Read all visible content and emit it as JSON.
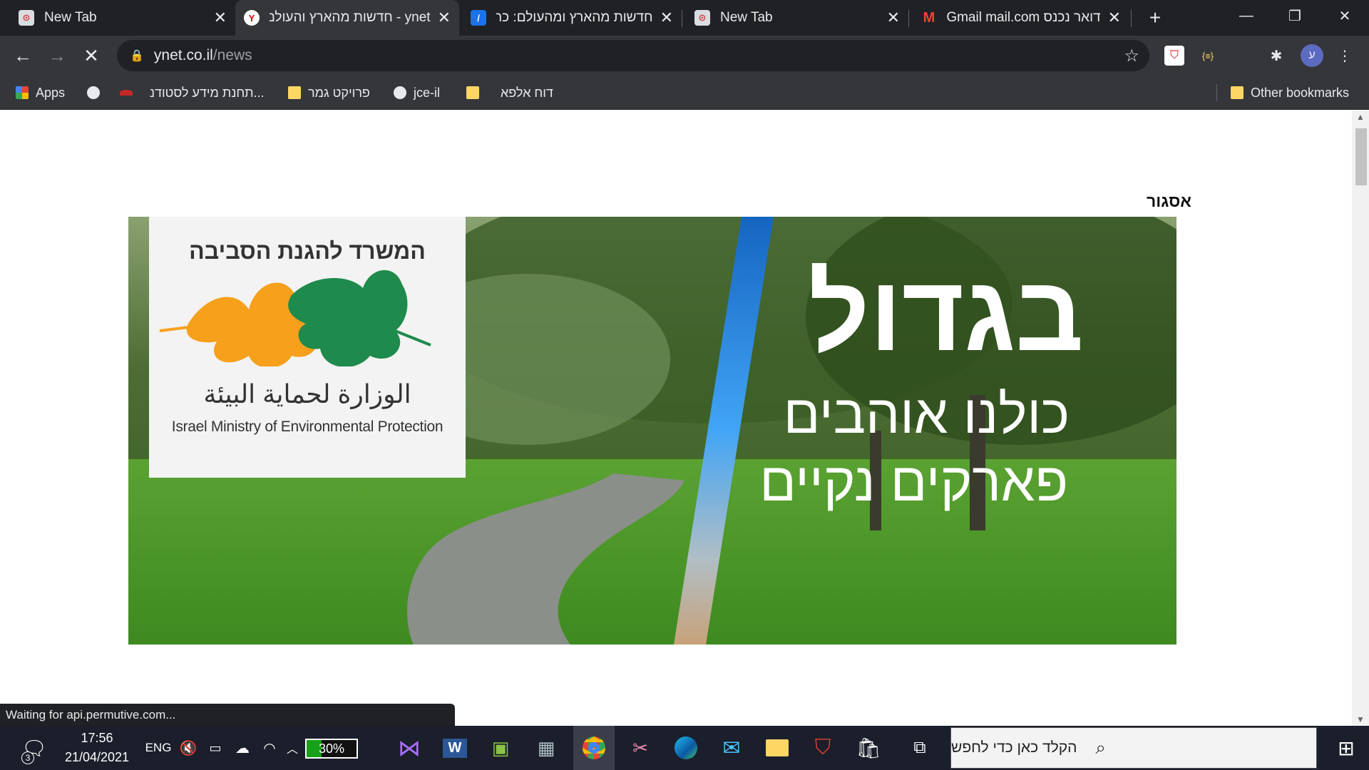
{
  "tabs": [
    {
      "title": "New Tab",
      "favicon": "chrome-newtab-icon"
    },
    {
      "title": "ynet - חדשות מהארץ והעולם",
      "favicon": "ynet-icon",
      "active": true
    },
    {
      "title": "חדשות מהארץ ומהעולם: כת",
      "favicon": "news-icon"
    },
    {
      "title": "New Tab",
      "favicon": "chrome-newtab-icon"
    },
    {
      "title": "דואר נכנס Gmail mail.com",
      "favicon": "gmail-icon"
    }
  ],
  "address": {
    "host": "ynet.co.il",
    "path": "/news"
  },
  "profile_initial": "ע",
  "bookmarks": [
    {
      "label": "Apps"
    },
    {
      "label": ""
    },
    {
      "label": "תחנת מידע לסטודנ..."
    },
    {
      "label": "פרויקט גמר"
    },
    {
      "label": "jce-il"
    },
    {
      "label": "דוח אלפא"
    }
  ],
  "other_bookmarks": "Other bookmarks",
  "ad": {
    "close_label": "אסגור",
    "ministry_he": "המשרד להגנת הסביבה",
    "ministry_ar": "الوزارة لحماية البيئة",
    "ministry_en": "Israel Ministry of Environmental Protection",
    "headline_big": "בגדול",
    "headline_line2": "כולנו אוהבים",
    "headline_line3": "פארקים נקיים"
  },
  "status_text": "Waiting for api.permutive.com...",
  "taskbar": {
    "notification_count": "3",
    "time": "17:56",
    "date": "21/04/2021",
    "language": "ENG",
    "battery": "30%",
    "search_placeholder": "הקלד כאן כדי לחפש"
  },
  "colors": {
    "tab_bg": "#202124",
    "toolbar_bg": "#35363a",
    "taskbar_bg": "#1b1e2b"
  }
}
